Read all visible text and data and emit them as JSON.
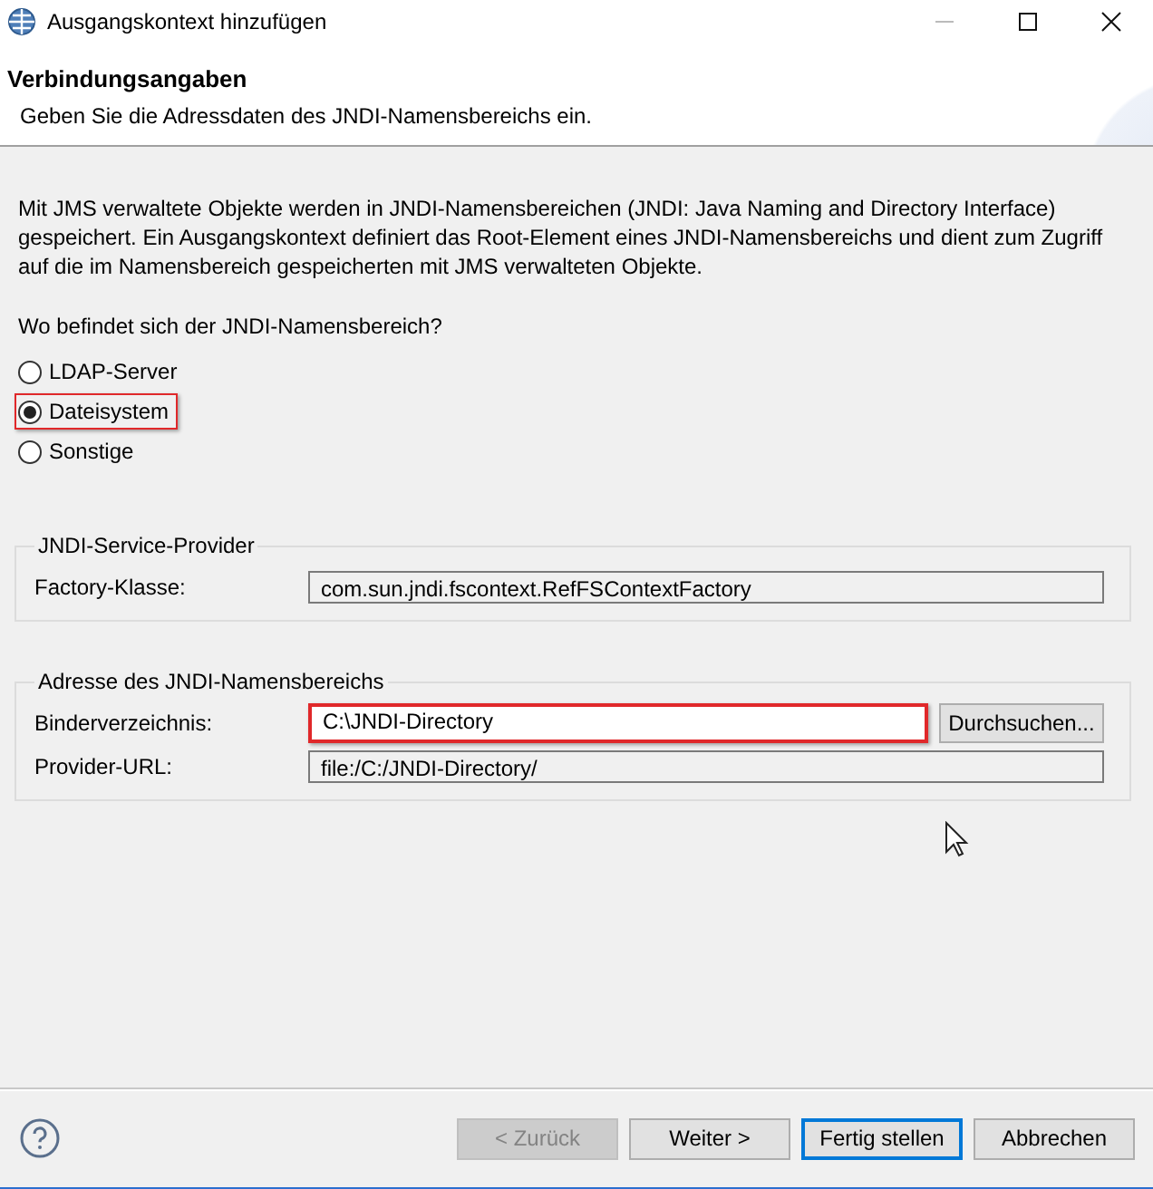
{
  "window": {
    "title": "Ausgangskontext hinzufügen"
  },
  "header": {
    "title": "Verbindungsangaben",
    "description": "Geben Sie die Adressdaten des JNDI-Namensbereichs ein."
  },
  "intro": "Mit JMS verwaltete Objekte werden in JNDI-Namensbereichen (JNDI: Java Naming and Directory Interface) gespeichert. Ein Ausgangskontext definiert das Root-Element eines JNDI-Namensbereichs und dient zum Zugriff auf die im Namensbereich gespeicherten mit JMS verwalteten Objekte.",
  "question": "Wo befindet sich der JNDI-Namensbereich?",
  "options": [
    {
      "label": "LDAP-Server",
      "selected": false,
      "highlighted": false
    },
    {
      "label": "Dateisystem",
      "selected": true,
      "highlighted": true
    },
    {
      "label": "Sonstige",
      "selected": false,
      "highlighted": false
    }
  ],
  "groups": [
    {
      "title": "JNDI-Service-Provider",
      "fields": [
        {
          "label": "Factory-Klasse:",
          "value": "com.sun.jndi.fscontext.RefFSContextFactory",
          "editable": false,
          "highlighted": false
        }
      ]
    },
    {
      "title": "Adresse des JNDI-Namensbereichs",
      "fields": [
        {
          "label": "Binderverzeichnis:",
          "value": "C:\\JNDI-Directory",
          "editable": true,
          "highlighted": true,
          "button": "Durchsuchen..."
        },
        {
          "label": "Provider-URL:",
          "value": "file:/C:/JNDI-Directory/",
          "editable": false,
          "highlighted": false
        }
      ]
    }
  ],
  "buttons": [
    {
      "label": "< Zurück",
      "disabled": true,
      "default": false
    },
    {
      "label": "Weiter >",
      "disabled": false,
      "default": false
    },
    {
      "label": "Fertig stellen",
      "disabled": false,
      "default": true
    },
    {
      "label": "Abbrechen",
      "disabled": false,
      "default": false
    }
  ]
}
